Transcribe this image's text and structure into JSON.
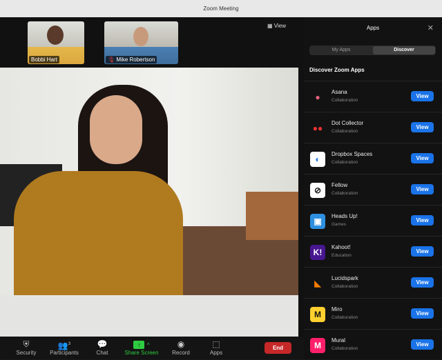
{
  "window": {
    "title": "Zoom Meeting"
  },
  "stage": {
    "view_label": "View",
    "participants": [
      {
        "name": "Bobbi Hart"
      },
      {
        "name": "Mike Robertson"
      }
    ]
  },
  "toolbar": {
    "security": "Security",
    "participants": "Participants",
    "participant_count": "3",
    "chat": "Chat",
    "share": "Share Screen",
    "record": "Record",
    "apps": "Apps",
    "end": "End"
  },
  "panel": {
    "title": "Apps",
    "tabs": [
      "My Apps",
      "Discover"
    ],
    "active_tab": "Discover",
    "heading": "Discover Zoom Apps",
    "view_label": "View",
    "apps": [
      {
        "name": "Asana",
        "category": "Collaboration",
        "color": "#121212"
      },
      {
        "name": "Dot Collector",
        "category": "Collaboration",
        "color": "#121212"
      },
      {
        "name": "Dropbox Spaces",
        "category": "Collaboration",
        "color": "#ffffff"
      },
      {
        "name": "Fellow",
        "category": "Collaboration",
        "color": "#ffffff"
      },
      {
        "name": "Heads Up!",
        "category": "Games",
        "color": "#2f8fe0"
      },
      {
        "name": "Kahoot!",
        "category": "Education",
        "color": "#46178f"
      },
      {
        "name": "Lucidspark",
        "category": "Collaboration",
        "color": "#121212"
      },
      {
        "name": "Miro",
        "category": "Collaboration",
        "color": "#ffd02f"
      },
      {
        "name": "Mural",
        "category": "Collaboration",
        "color": "#ff1f6b"
      }
    ]
  }
}
